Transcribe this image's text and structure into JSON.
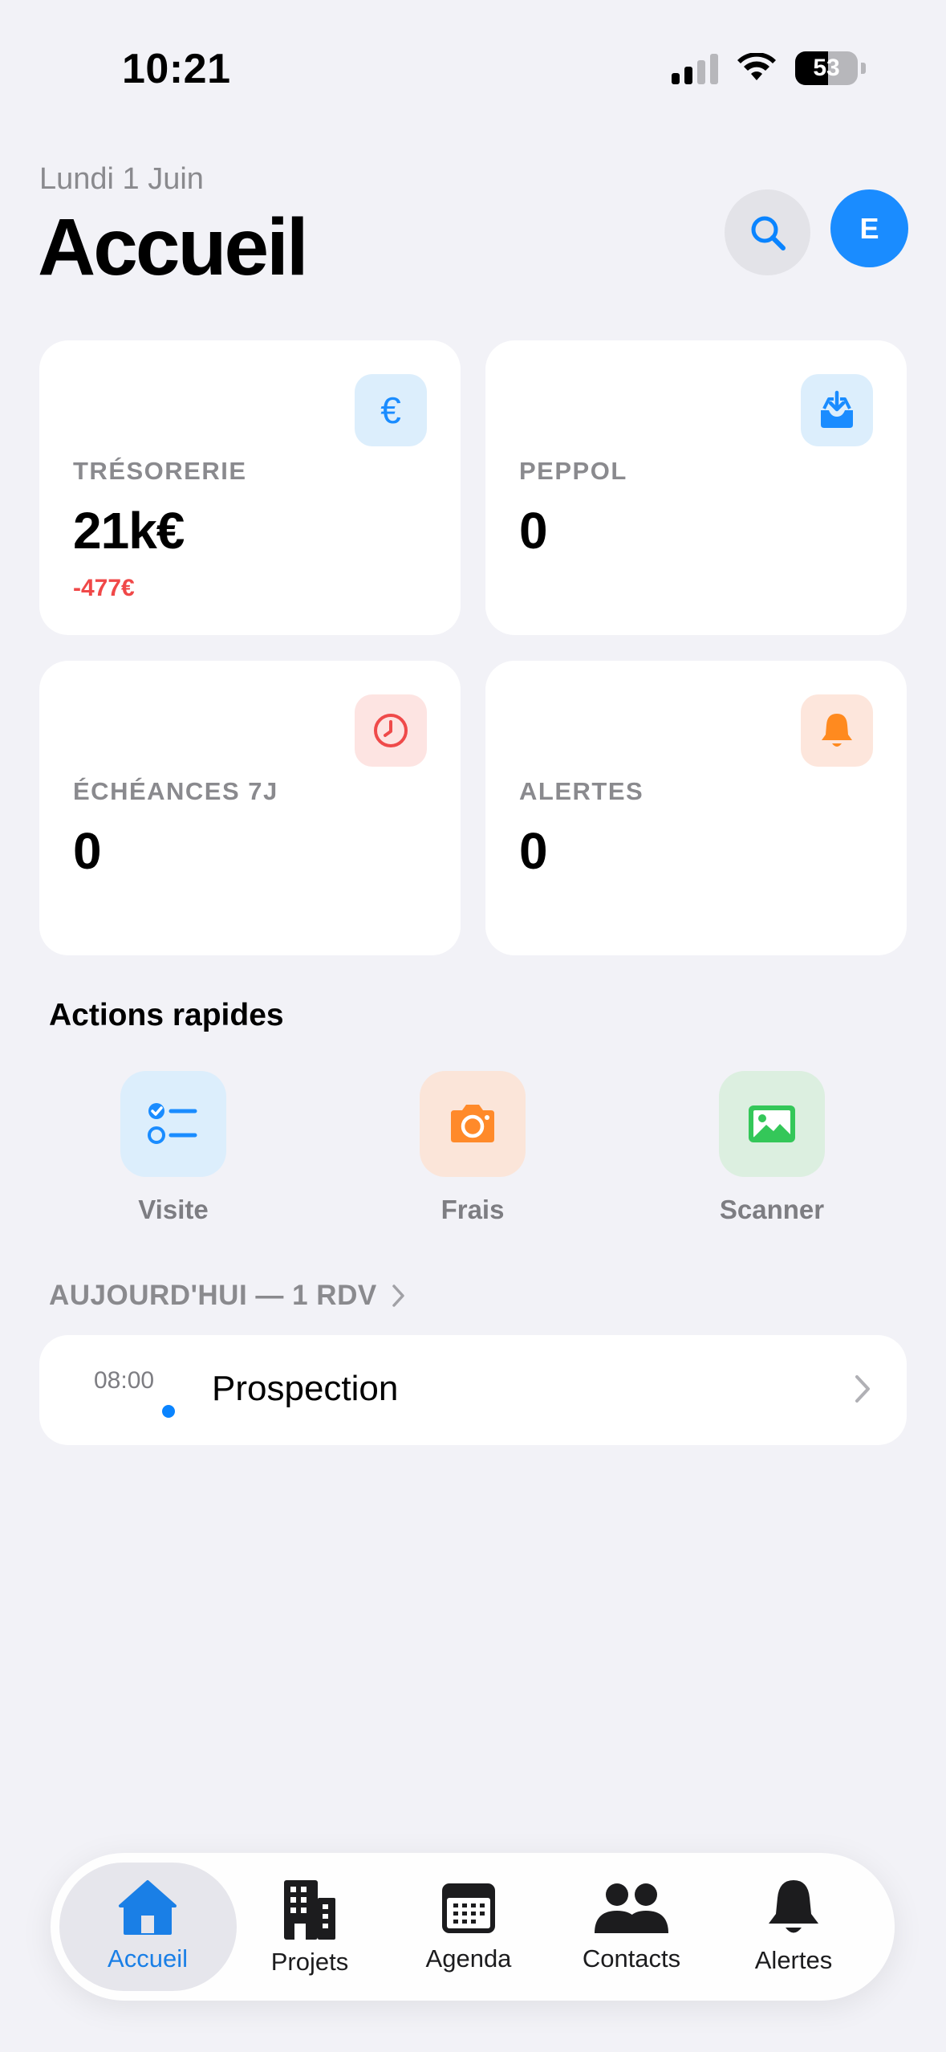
{
  "status": {
    "time": "10:21",
    "battery": "53"
  },
  "header": {
    "date": "Lundi 1 Juin",
    "title": "Accueil",
    "avatar_initial": "E"
  },
  "cards": [
    {
      "label": "TRÉSORERIE",
      "value": "21k€",
      "delta": "-477€",
      "icon": "euro-icon",
      "color": "#1a8cff",
      "bg": "#dceefc"
    },
    {
      "label": "PEPPOL",
      "value": "0",
      "icon": "inbox-download-icon",
      "color": "#1a8cff",
      "bg": "#dceefc"
    },
    {
      "label": "ÉCHÉANCES 7J",
      "value": "0",
      "icon": "clock-icon",
      "color": "#ef4a4a",
      "bg": "#fde4e2"
    },
    {
      "label": "ALERTES",
      "value": "0",
      "icon": "bell-icon",
      "color": "#ff8a1f",
      "bg": "#fde6dc"
    }
  ],
  "quick_actions": {
    "title": "Actions rapides",
    "items": [
      {
        "label": "Visite",
        "icon": "checklist-icon",
        "color": "#1a8cff",
        "bg": "#dceefc"
      },
      {
        "label": "Frais",
        "icon": "camera-icon",
        "color": "#ff8a2a",
        "bg": "#fbe5d9"
      },
      {
        "label": "Scanner",
        "icon": "photo-icon",
        "color": "#34c759",
        "bg": "#dcefe0"
      }
    ]
  },
  "today": {
    "heading": "AUJOURD'HUI — 1 RDV",
    "events": [
      {
        "time": "08:00",
        "title": "Prospection"
      }
    ]
  },
  "tabbar": {
    "active_color": "#1a7fe6",
    "tabs": [
      {
        "label": "Accueil",
        "icon": "home-icon",
        "active": true
      },
      {
        "label": "Projets",
        "icon": "building-icon"
      },
      {
        "label": "Agenda",
        "icon": "calendar-icon"
      },
      {
        "label": "Contacts",
        "icon": "people-icon"
      },
      {
        "label": "Alertes",
        "icon": "bell-icon"
      }
    ]
  }
}
